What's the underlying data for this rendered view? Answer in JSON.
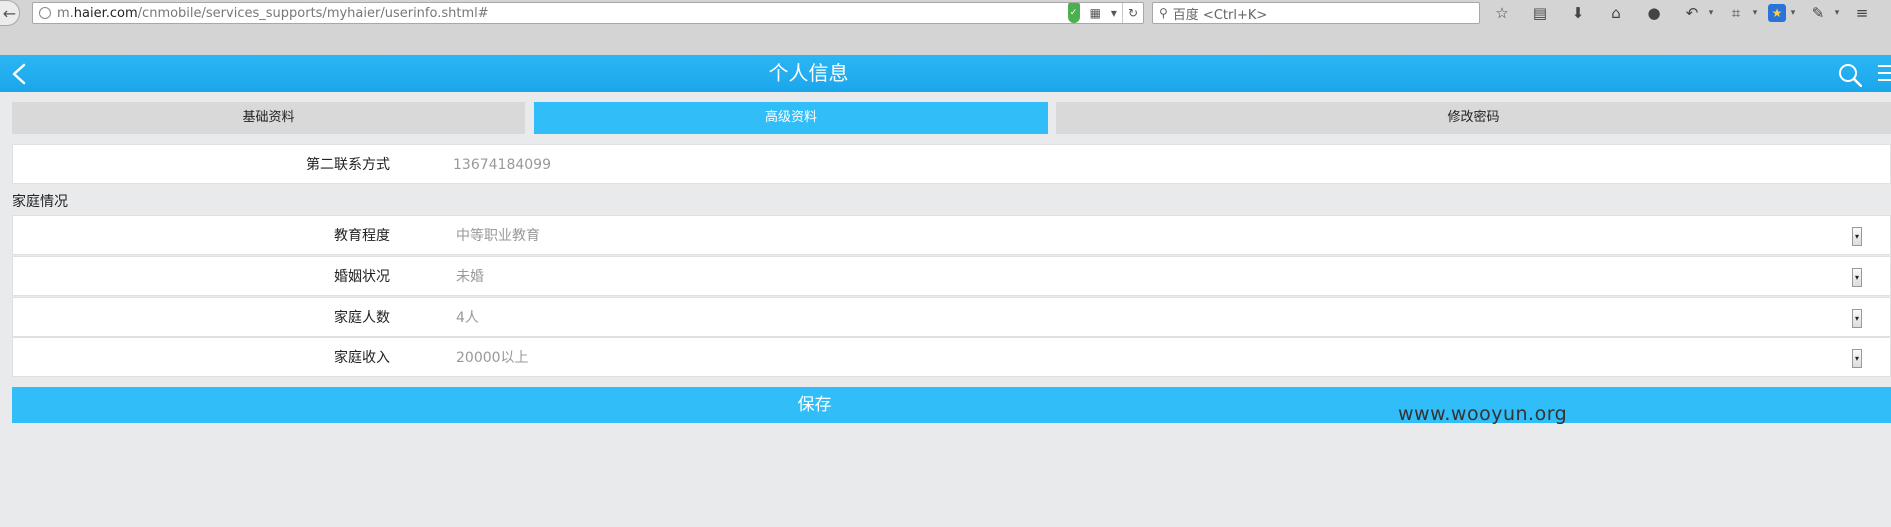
{
  "browser": {
    "url_prefix": "m.",
    "url_domain": "haier.com",
    "url_path": "/cnmobile/services_supports/myhaier/userinfo.shtml#",
    "search_placeholder": "百度 <Ctrl+K>"
  },
  "header": {
    "title": "个人信息"
  },
  "tabs": [
    {
      "label": "基础资料",
      "active": false
    },
    {
      "label": "高级资料",
      "active": true
    },
    {
      "label": "修改密码",
      "active": false
    }
  ],
  "contact": {
    "label": "第二联系方式",
    "value": "13674184099"
  },
  "family": {
    "section_title": "家庭情况",
    "rows": [
      {
        "label": "教育程度",
        "value": "中等职业教育"
      },
      {
        "label": "婚姻状况",
        "value": "未婚"
      },
      {
        "label": "家庭人数",
        "value": "4人"
      },
      {
        "label": "家庭收入",
        "value": "20000以上"
      }
    ]
  },
  "save_label": "保存",
  "watermark": "www.wooyun.org",
  "colors": {
    "accent": "#31bdf7",
    "header": "#1aa6ea",
    "tab_inactive": "#d9d9d9",
    "background": "#e9eaec"
  }
}
